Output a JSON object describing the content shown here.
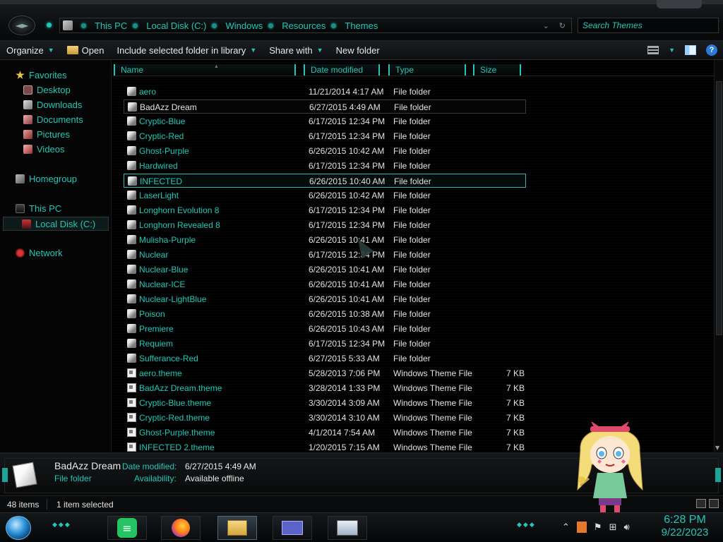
{
  "address": {
    "crumbs": [
      "This PC",
      "Local Disk (C:)",
      "Windows",
      "Resources",
      "Themes"
    ],
    "search_placeholder": "Search Themes"
  },
  "toolbar": {
    "organize": "Organize",
    "open": "Open",
    "include": "Include selected folder in library",
    "share": "Share with",
    "new_folder": "New folder",
    "help": "?"
  },
  "nav": {
    "favorites": "Favorites",
    "desktop": "Desktop",
    "downloads": "Downloads",
    "documents": "Documents",
    "pictures": "Pictures",
    "videos": "Videos",
    "homegroup": "Homegroup",
    "this_pc": "This PC",
    "local_disk": "Local Disk (C:)",
    "network": "Network"
  },
  "columns": {
    "name": "Name",
    "date": "Date modified",
    "type": "Type",
    "size": "Size"
  },
  "files": [
    {
      "name": "aero",
      "date": "11/21/2014 4:17 AM",
      "type": "File folder",
      "size": "",
      "kind": "folder"
    },
    {
      "name": "BadAzz Dream",
      "date": "6/27/2015 4:49 AM",
      "type": "File folder",
      "size": "",
      "kind": "folder"
    },
    {
      "name": "Cryptic-Blue",
      "date": "6/17/2015 12:34 PM",
      "type": "File folder",
      "size": "",
      "kind": "folder"
    },
    {
      "name": "Cryptic-Red",
      "date": "6/17/2015 12:34 PM",
      "type": "File folder",
      "size": "",
      "kind": "folder"
    },
    {
      "name": "Ghost-Purple",
      "date": "6/26/2015 10:42 AM",
      "type": "File folder",
      "size": "",
      "kind": "folder"
    },
    {
      "name": "Hardwired",
      "date": "6/17/2015 12:34 PM",
      "type": "File folder",
      "size": "",
      "kind": "folder"
    },
    {
      "name": "INFECTED",
      "date": "6/26/2015 10:40 AM",
      "type": "File folder",
      "size": "",
      "kind": "folder"
    },
    {
      "name": "LaserLight",
      "date": "6/26/2015 10:42 AM",
      "type": "File folder",
      "size": "",
      "kind": "folder"
    },
    {
      "name": "Longhorn Evolution 8",
      "date": "6/17/2015 12:34 PM",
      "type": "File folder",
      "size": "",
      "kind": "folder"
    },
    {
      "name": "Longhorn Revealed 8",
      "date": "6/17/2015 12:34 PM",
      "type": "File folder",
      "size": "",
      "kind": "folder"
    },
    {
      "name": "Mulisha-Purple",
      "date": "6/26/2015 10:41 AM",
      "type": "File folder",
      "size": "",
      "kind": "folder"
    },
    {
      "name": "Nuclear",
      "date": "6/17/2015 12:34 PM",
      "type": "File folder",
      "size": "",
      "kind": "folder"
    },
    {
      "name": "Nuclear-Blue",
      "date": "6/26/2015 10:41 AM",
      "type": "File folder",
      "size": "",
      "kind": "folder"
    },
    {
      "name": "Nuclear-ICE",
      "date": "6/26/2015 10:41 AM",
      "type": "File folder",
      "size": "",
      "kind": "folder"
    },
    {
      "name": "Nuclear-LightBlue",
      "date": "6/26/2015 10:41 AM",
      "type": "File folder",
      "size": "",
      "kind": "folder"
    },
    {
      "name": "Poison",
      "date": "6/26/2015 10:38 AM",
      "type": "File folder",
      "size": "",
      "kind": "folder"
    },
    {
      "name": "Premiere",
      "date": "6/26/2015 10:43 AM",
      "type": "File folder",
      "size": "",
      "kind": "folder"
    },
    {
      "name": "Requiem",
      "date": "6/17/2015 12:34 PM",
      "type": "File folder",
      "size": "",
      "kind": "folder"
    },
    {
      "name": "Sufferance-Red",
      "date": "6/27/2015 5:33 AM",
      "type": "File folder",
      "size": "",
      "kind": "folder"
    },
    {
      "name": "aero.theme",
      "date": "5/28/2013 7:06 PM",
      "type": "Windows Theme File",
      "size": "7 KB",
      "kind": "theme"
    },
    {
      "name": "BadAzz Dream.theme",
      "date": "3/28/2014 1:33 PM",
      "type": "Windows Theme File",
      "size": "7 KB",
      "kind": "theme"
    },
    {
      "name": "Cryptic-Blue.theme",
      "date": "3/30/2014 3:09 AM",
      "type": "Windows Theme File",
      "size": "7 KB",
      "kind": "theme"
    },
    {
      "name": "Cryptic-Red.theme",
      "date": "3/30/2014 3:10 AM",
      "type": "Windows Theme File",
      "size": "7 KB",
      "kind": "theme"
    },
    {
      "name": "Ghost-Purple.theme",
      "date": "4/1/2014 7:54 AM",
      "type": "Windows Theme File",
      "size": "7 KB",
      "kind": "theme"
    },
    {
      "name": "INFECTED 2.theme",
      "date": "1/20/2015 7:15 AM",
      "type": "Windows Theme File",
      "size": "7 KB",
      "kind": "theme"
    }
  ],
  "selected": {
    "highlight_row": 1,
    "focus_row": 6
  },
  "details": {
    "name": "BadAzz Dream",
    "kind": "File folder",
    "date_label": "Date modified:",
    "date_value": "6/27/2015 4:49 AM",
    "avail_label": "Availability:",
    "avail_value": "Available offline"
  },
  "status": {
    "count": "48 items",
    "selection": "1 item selected"
  },
  "clock": {
    "time": "6:28 PM",
    "date": "9/22/2023"
  },
  "colors": {
    "accent": "#1fc8b8",
    "background": "#000000"
  }
}
